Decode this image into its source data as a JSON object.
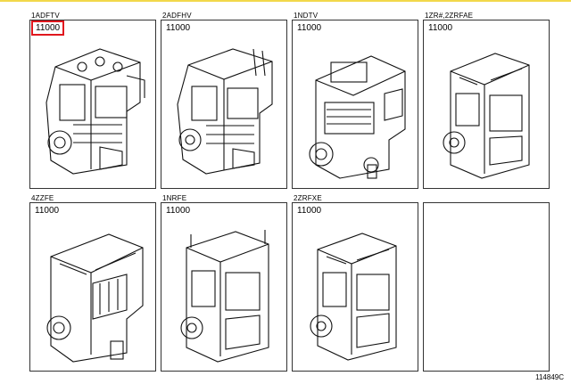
{
  "catalog": {
    "cells": [
      {
        "code": "1ADFTV",
        "part_number": "11000",
        "highlighted": true
      },
      {
        "code": "2ADFHV",
        "part_number": "11000",
        "highlighted": false
      },
      {
        "code": "1NDTV",
        "part_number": "11000",
        "highlighted": false
      },
      {
        "code": "1ZR#,2ZRFAE",
        "part_number": "11000",
        "highlighted": false
      },
      {
        "code": "4ZZFE",
        "part_number": "11000",
        "highlighted": false
      },
      {
        "code": "1NRFE",
        "part_number": "11000",
        "highlighted": false
      },
      {
        "code": "2ZRFXE",
        "part_number": "11000",
        "highlighted": false
      },
      {
        "code": "",
        "part_number": "",
        "highlighted": false
      }
    ],
    "highlight_color": "#e0171e",
    "border_accent": "#f2d84a"
  },
  "footer": {
    "illustration_number": "114849C"
  }
}
